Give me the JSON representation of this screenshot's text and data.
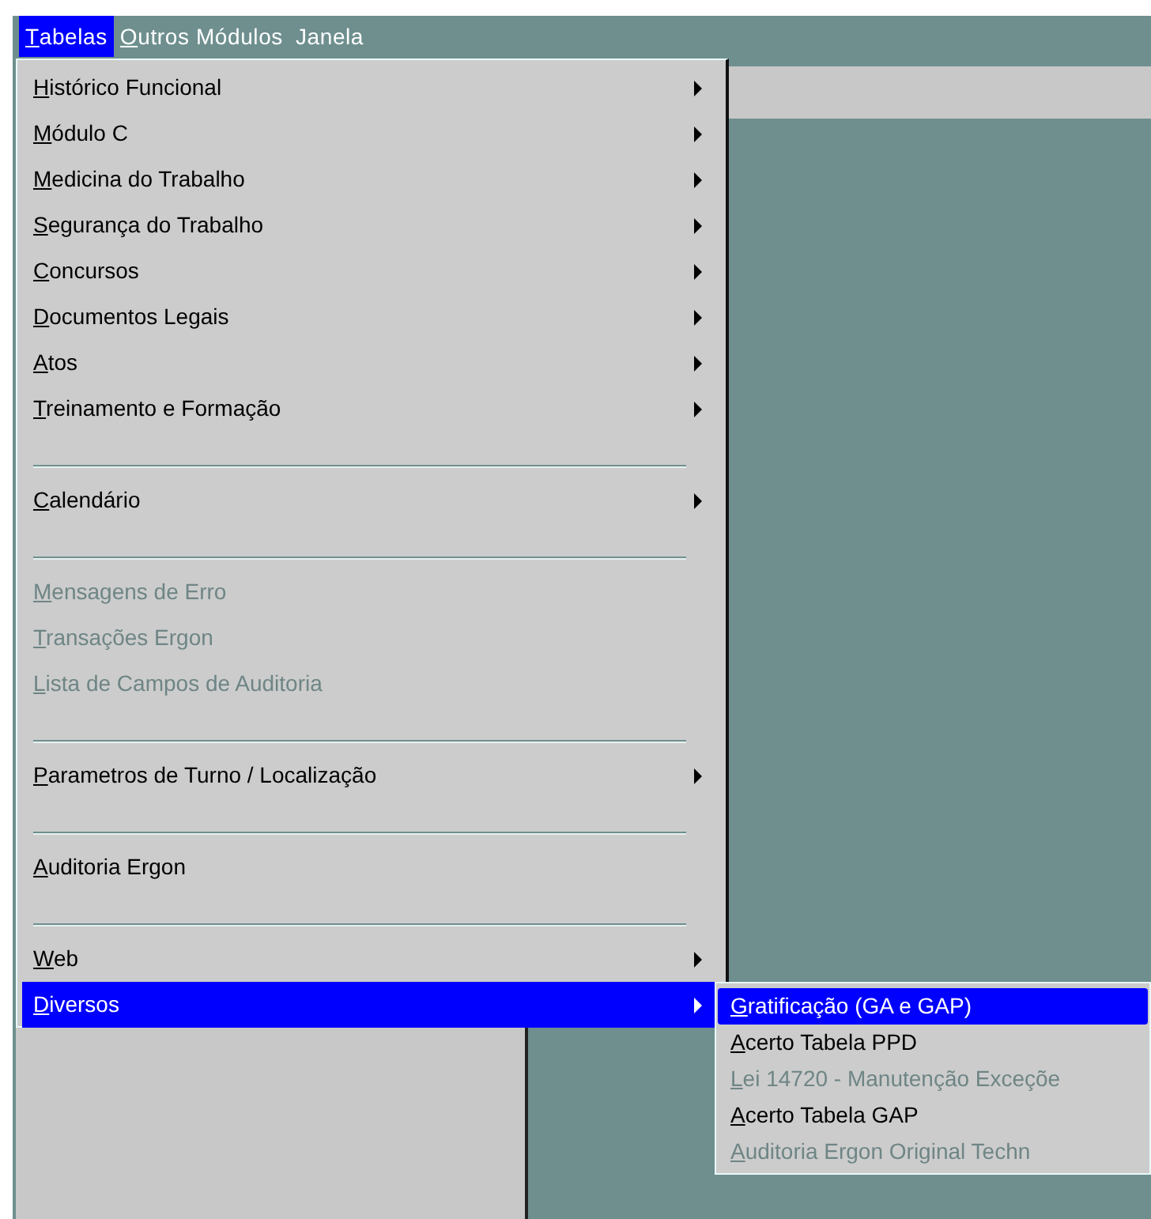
{
  "menubar": [
    {
      "label": "Tabelas",
      "mnemonic": true,
      "selected": true
    },
    {
      "label": "Outros Módulos",
      "mnemonic": true,
      "selected": false
    },
    {
      "label": "Janela",
      "mnemonic": false,
      "selected": false
    }
  ],
  "menu": {
    "items": [
      {
        "kind": "item",
        "label": "Histórico Funcional",
        "submenu": true,
        "disabled": false,
        "selected": false
      },
      {
        "kind": "item",
        "label": "Módulo C",
        "submenu": true,
        "disabled": false,
        "selected": false
      },
      {
        "kind": "item",
        "label": "Medicina do Trabalho",
        "submenu": true,
        "disabled": false,
        "selected": false
      },
      {
        "kind": "item",
        "label": "Segurança do Trabalho",
        "submenu": true,
        "disabled": false,
        "selected": false
      },
      {
        "kind": "item",
        "label": "Concursos",
        "submenu": true,
        "disabled": false,
        "selected": false
      },
      {
        "kind": "item",
        "label": "Documentos Legais",
        "submenu": true,
        "disabled": false,
        "selected": false
      },
      {
        "kind": "item",
        "label": "Atos",
        "submenu": true,
        "disabled": false,
        "selected": false
      },
      {
        "kind": "item",
        "label": "Treinamento e Formação",
        "submenu": true,
        "disabled": false,
        "selected": false
      },
      {
        "kind": "separator"
      },
      {
        "kind": "item",
        "label": "Calendário",
        "submenu": true,
        "disabled": false,
        "selected": false
      },
      {
        "kind": "separator"
      },
      {
        "kind": "item",
        "label": "Mensagens de Erro",
        "submenu": false,
        "disabled": true,
        "selected": false
      },
      {
        "kind": "item",
        "label": "Transações Ergon",
        "submenu": false,
        "disabled": true,
        "selected": false
      },
      {
        "kind": "item",
        "label": "Lista de Campos de Auditoria",
        "submenu": false,
        "disabled": true,
        "selected": false
      },
      {
        "kind": "separator"
      },
      {
        "kind": "item",
        "label": "Parametros de Turno / Localização",
        "submenu": true,
        "disabled": false,
        "selected": false
      },
      {
        "kind": "separator"
      },
      {
        "kind": "item",
        "label": "Auditoria Ergon",
        "submenu": false,
        "disabled": false,
        "selected": false
      },
      {
        "kind": "separator"
      },
      {
        "kind": "item",
        "label": "Web",
        "submenu": true,
        "disabled": false,
        "selected": false
      },
      {
        "kind": "item",
        "label": "Diversos",
        "submenu": true,
        "disabled": false,
        "selected": true
      }
    ]
  },
  "submenu": {
    "items": [
      {
        "label": "Gratificação (GA e GAP)",
        "disabled": false,
        "selected": true
      },
      {
        "label": "Acerto Tabela PPD",
        "disabled": false,
        "selected": false
      },
      {
        "label": "Lei 14720 - Manutenção Exceçõe",
        "disabled": true,
        "selected": false
      },
      {
        "label": "Acerto Tabela GAP",
        "disabled": false,
        "selected": false
      },
      {
        "label": "Auditoria Ergon Original Techn",
        "disabled": true,
        "selected": false
      }
    ]
  }
}
